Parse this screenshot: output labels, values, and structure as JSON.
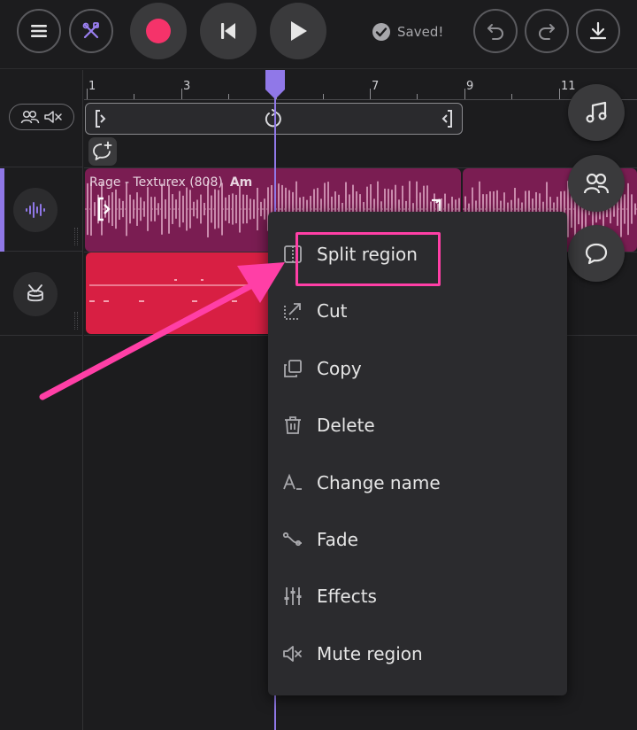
{
  "toolbar": {
    "saved_text": "Saved!",
    "record_color": "#f5336a"
  },
  "ruler": {
    "bars": [
      "1",
      "3",
      "7",
      "9",
      "11"
    ]
  },
  "tracks": [
    {
      "icon": "waveform-icon",
      "clip_name": "Rage - Texturex (808)",
      "clip_key": "Am",
      "clip_color": "#7a1d52"
    },
    {
      "icon": "drum-icon",
      "clip_color": "#d81f43"
    }
  ],
  "context_menu": {
    "items": [
      {
        "icon": "split-icon",
        "label": "Split region"
      },
      {
        "icon": "cut-icon",
        "label": "Cut"
      },
      {
        "icon": "copy-icon",
        "label": "Copy"
      },
      {
        "icon": "trash-icon",
        "label": "Delete"
      },
      {
        "icon": "rename-icon",
        "label": "Change name"
      },
      {
        "icon": "fade-icon",
        "label": "Fade"
      },
      {
        "icon": "sliders-icon",
        "label": "Effects"
      },
      {
        "icon": "mute-icon",
        "label": "Mute region"
      }
    ]
  },
  "colors": {
    "accent": "#9078e8",
    "highlight": "#ff3fa6"
  }
}
